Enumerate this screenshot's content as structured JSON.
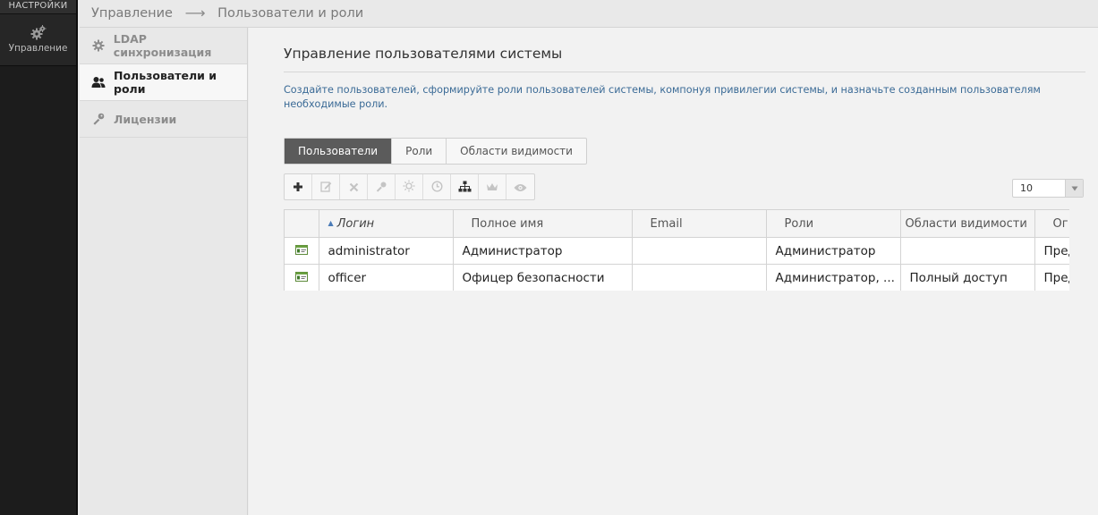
{
  "leftbar": {
    "header": "НАСТРОЙКИ",
    "items": [
      {
        "label": "Управление",
        "icon": "gears-icon"
      }
    ]
  },
  "breadcrumb": {
    "items": [
      "Управление",
      "Пользователи и роли"
    ],
    "separator": "⟶"
  },
  "sidebar": {
    "items": [
      {
        "label": "LDAP синхронизация",
        "icon": "gear-icon",
        "active": false
      },
      {
        "label": "Пользователи и роли",
        "icon": "users-icon",
        "active": true
      },
      {
        "label": "Лицензии",
        "icon": "key-icon",
        "active": false
      }
    ]
  },
  "main": {
    "title": "Управление пользователями системы",
    "description": "Создайте пользователей, сформируйте роли пользователей системы, компонуя привилегии системы, и назначьте созданным пользователям необходимые роли.",
    "tabs": [
      {
        "label": "Пользователи",
        "active": true
      },
      {
        "label": "Роли",
        "active": false
      },
      {
        "label": "Области видимости",
        "active": false
      }
    ],
    "toolbar": [
      "add-icon",
      "edit-icon",
      "delete-icon",
      "key-icon",
      "sun-icon",
      "clock-icon",
      "hierarchy-icon",
      "crown-icon",
      "eye-icon"
    ],
    "page_size": {
      "value": "10"
    }
  },
  "table": {
    "columns": [
      "",
      "Логин",
      "Полное имя",
      "Email",
      "Роли",
      "Области видимости",
      "Ог"
    ],
    "sorted_column": "Логин",
    "rows": [
      {
        "login": "administrator",
        "full_name": "Администратор",
        "email": "",
        "roles": "Администратор",
        "scopes": "",
        "extra": "Пред"
      },
      {
        "login": "officer",
        "full_name": "Офицер безопасности",
        "email": "",
        "roles": "Администратор, ...",
        "scopes": "Полный доступ",
        "extra": "Пред"
      }
    ]
  },
  "colors": {
    "accent": "#4a7bb7",
    "active_tab": "#5b5b5b",
    "leftbar": "#1c1c1c"
  }
}
